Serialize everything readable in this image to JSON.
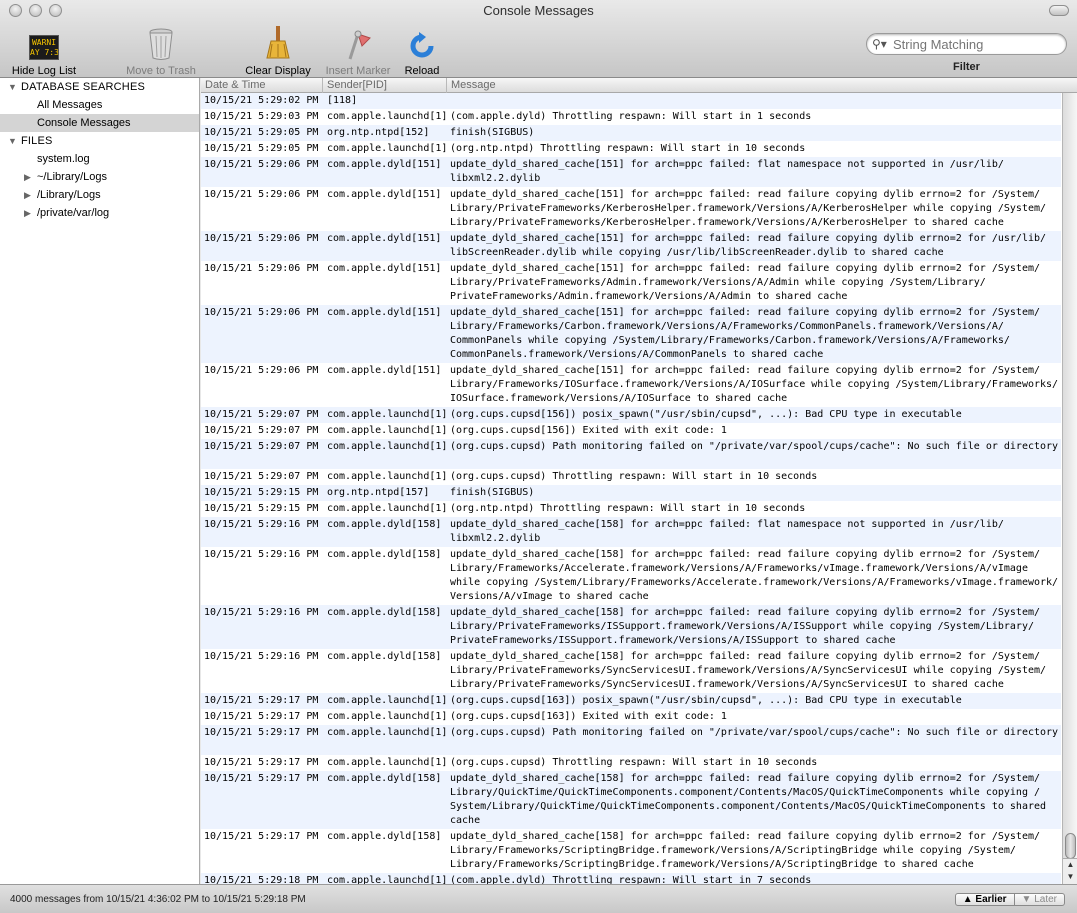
{
  "window": {
    "title": "Console Messages"
  },
  "toolbar": {
    "hide_log_list": "Hide Log List",
    "move_to_trash": "Move to Trash",
    "clear_display": "Clear Display",
    "insert_marker": "Insert Marker",
    "reload": "Reload",
    "warn_icon_text": "WARNI\nAY 7:36",
    "search_placeholder": "String Matching",
    "filter_label": "Filter"
  },
  "sidebar": {
    "db_header": "DATABASE SEARCHES",
    "db_items": [
      "All Messages",
      "Console Messages"
    ],
    "files_header": "FILES",
    "file_items": [
      "system.log",
      "~/Library/Logs",
      "/Library/Logs",
      "/private/var/log"
    ]
  },
  "table": {
    "columns": [
      "Date & Time",
      "Sender[PID]",
      "Message"
    ],
    "rows": [
      {
        "date": "10/15/21 5:29:02 PM",
        "sender": "[118]",
        "msg": ""
      },
      {
        "date": "10/15/21 5:29:03 PM",
        "sender": "com.apple.launchd[1]",
        "msg": "(com.apple.dyld) Throttling respawn: Will start in 1 seconds"
      },
      {
        "date": "10/15/21 5:29:05 PM",
        "sender": "org.ntp.ntpd[152]",
        "msg": "finish(SIGBUS)"
      },
      {
        "date": "10/15/21 5:29:05 PM",
        "sender": "com.apple.launchd[1]",
        "msg": "(org.ntp.ntpd) Throttling respawn: Will start in 10 seconds"
      },
      {
        "date": "10/15/21 5:29:06 PM",
        "sender": "com.apple.dyld[151]",
        "msg": "update_dyld_shared_cache[151] for arch=ppc failed: flat namespace not supported in /usr/lib/\nlibxml2.2.dylib"
      },
      {
        "date": "10/15/21 5:29:06 PM",
        "sender": "com.apple.dyld[151]",
        "msg": "update_dyld_shared_cache[151] for arch=ppc failed: read failure copying dylib errno=2 for /System/\nLibrary/PrivateFrameworks/KerberosHelper.framework/Versions/A/KerberosHelper while copying /System/\nLibrary/PrivateFrameworks/KerberosHelper.framework/Versions/A/KerberosHelper to shared cache"
      },
      {
        "date": "10/15/21 5:29:06 PM",
        "sender": "com.apple.dyld[151]",
        "msg": "update_dyld_shared_cache[151] for arch=ppc failed: read failure copying dylib errno=2 for /usr/lib/\nlibScreenReader.dylib while copying /usr/lib/libScreenReader.dylib to shared cache"
      },
      {
        "date": "10/15/21 5:29:06 PM",
        "sender": "com.apple.dyld[151]",
        "msg": "update_dyld_shared_cache[151] for arch=ppc failed: read failure copying dylib errno=2 for /System/\nLibrary/PrivateFrameworks/Admin.framework/Versions/A/Admin while copying /System/Library/\nPrivateFrameworks/Admin.framework/Versions/A/Admin to shared cache"
      },
      {
        "date": "10/15/21 5:29:06 PM",
        "sender": "com.apple.dyld[151]",
        "msg": "update_dyld_shared_cache[151] for arch=ppc failed: read failure copying dylib errno=2 for /System/\nLibrary/Frameworks/Carbon.framework/Versions/A/Frameworks/CommonPanels.framework/Versions/A/\nCommonPanels while copying /System/Library/Frameworks/Carbon.framework/Versions/A/Frameworks/\nCommonPanels.framework/Versions/A/CommonPanels to shared cache"
      },
      {
        "date": "10/15/21 5:29:06 PM",
        "sender": "com.apple.dyld[151]",
        "msg": "update_dyld_shared_cache[151] for arch=ppc failed: read failure copying dylib errno=2 for /System/\nLibrary/Frameworks/IOSurface.framework/Versions/A/IOSurface while copying /System/Library/Frameworks/\nIOSurface.framework/Versions/A/IOSurface to shared cache"
      },
      {
        "date": "10/15/21 5:29:07 PM",
        "sender": "com.apple.launchd[1]",
        "msg": "(org.cups.cupsd[156]) posix_spawn(\"/usr/sbin/cupsd\", ...): Bad CPU type in executable"
      },
      {
        "date": "10/15/21 5:29:07 PM",
        "sender": "com.apple.launchd[1]",
        "msg": "(org.cups.cupsd[156]) Exited with exit code: 1"
      },
      {
        "date": "10/15/21 5:29:07 PM",
        "sender": "com.apple.launchd[1]",
        "msg": "(org.cups.cupsd) Path monitoring failed on \"/private/var/spool/cups/cache\": No such file or directory\n "
      },
      {
        "date": "10/15/21 5:29:07 PM",
        "sender": "com.apple.launchd[1]",
        "msg": "(org.cups.cupsd) Throttling respawn: Will start in 10 seconds"
      },
      {
        "date": "10/15/21 5:29:15 PM",
        "sender": "org.ntp.ntpd[157]",
        "msg": "finish(SIGBUS)"
      },
      {
        "date": "10/15/21 5:29:15 PM",
        "sender": "com.apple.launchd[1]",
        "msg": "(org.ntp.ntpd) Throttling respawn: Will start in 10 seconds"
      },
      {
        "date": "10/15/21 5:29:16 PM",
        "sender": "com.apple.dyld[158]",
        "msg": "update_dyld_shared_cache[158] for arch=ppc failed: flat namespace not supported in /usr/lib/\nlibxml2.2.dylib"
      },
      {
        "date": "10/15/21 5:29:16 PM",
        "sender": "com.apple.dyld[158]",
        "msg": "update_dyld_shared_cache[158] for arch=ppc failed: read failure copying dylib errno=2 for /System/\nLibrary/Frameworks/Accelerate.framework/Versions/A/Frameworks/vImage.framework/Versions/A/vImage\nwhile copying /System/Library/Frameworks/Accelerate.framework/Versions/A/Frameworks/vImage.framework/\nVersions/A/vImage to shared cache"
      },
      {
        "date": "10/15/21 5:29:16 PM",
        "sender": "com.apple.dyld[158]",
        "msg": "update_dyld_shared_cache[158] for arch=ppc failed: read failure copying dylib errno=2 for /System/\nLibrary/PrivateFrameworks/ISSupport.framework/Versions/A/ISSupport while copying /System/Library/\nPrivateFrameworks/ISSupport.framework/Versions/A/ISSupport to shared cache"
      },
      {
        "date": "10/15/21 5:29:16 PM",
        "sender": "com.apple.dyld[158]",
        "msg": "update_dyld_shared_cache[158] for arch=ppc failed: read failure copying dylib errno=2 for /System/\nLibrary/PrivateFrameworks/SyncServicesUI.framework/Versions/A/SyncServicesUI while copying /System/\nLibrary/PrivateFrameworks/SyncServicesUI.framework/Versions/A/SyncServicesUI to shared cache"
      },
      {
        "date": "10/15/21 5:29:17 PM",
        "sender": "com.apple.launchd[1]",
        "msg": "(org.cups.cupsd[163]) posix_spawn(\"/usr/sbin/cupsd\", ...): Bad CPU type in executable"
      },
      {
        "date": "10/15/21 5:29:17 PM",
        "sender": "com.apple.launchd[1]",
        "msg": "(org.cups.cupsd[163]) Exited with exit code: 1"
      },
      {
        "date": "10/15/21 5:29:17 PM",
        "sender": "com.apple.launchd[1]",
        "msg": "(org.cups.cupsd) Path monitoring failed on \"/private/var/spool/cups/cache\": No such file or directory\n "
      },
      {
        "date": "10/15/21 5:29:17 PM",
        "sender": "com.apple.launchd[1]",
        "msg": "(org.cups.cupsd) Throttling respawn: Will start in 10 seconds"
      },
      {
        "date": "10/15/21 5:29:17 PM",
        "sender": "com.apple.dyld[158]",
        "msg": "update_dyld_shared_cache[158] for arch=ppc failed: read failure copying dylib errno=2 for /System/\nLibrary/QuickTime/QuickTimeComponents.component/Contents/MacOS/QuickTimeComponents while copying /\nSystem/Library/QuickTime/QuickTimeComponents.component/Contents/MacOS/QuickTimeComponents to shared\ncache"
      },
      {
        "date": "10/15/21 5:29:17 PM",
        "sender": "com.apple.dyld[158]",
        "msg": "update_dyld_shared_cache[158] for arch=ppc failed: read failure copying dylib errno=2 for /System/\nLibrary/Frameworks/ScriptingBridge.framework/Versions/A/ScriptingBridge while copying /System/\nLibrary/Frameworks/ScriptingBridge.framework/Versions/A/ScriptingBridge to shared cache"
      },
      {
        "date": "10/15/21 5:29:18 PM",
        "sender": "com.apple.launchd[1]",
        "msg": "(com.apple.dyld) Throttling respawn: Will start in 7 seconds"
      }
    ]
  },
  "status": {
    "text": "4000 messages from 10/15/21 4:36:02 PM to 10/15/21 5:29:18 PM",
    "earlier": "▲ Earlier",
    "later": "▼ Later"
  }
}
